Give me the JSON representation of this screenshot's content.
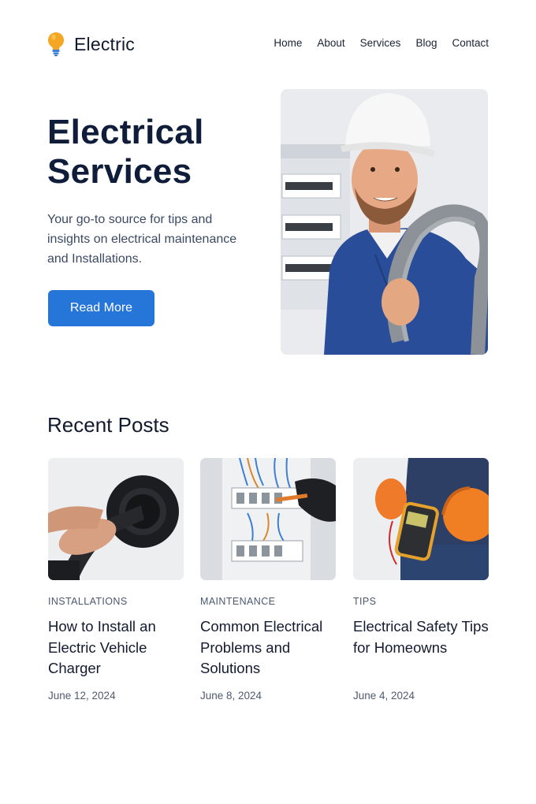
{
  "brand": {
    "name": "Electric",
    "icon": "lightbulb-icon",
    "accent": "#f5a623"
  },
  "nav": {
    "items": [
      "Home",
      "About",
      "Services",
      "Blog",
      "Contact"
    ]
  },
  "hero": {
    "title": "Electrical Services",
    "text": "Your go-to source for tips and insights on electrical maintenance and Installations.",
    "button": "Read More",
    "button_color": "#2675d9",
    "image": "electrician-photo"
  },
  "recent": {
    "title": "Recent Posts",
    "posts": [
      {
        "category": "INSTALLATIONS",
        "title": "How to Install an Electric Vehicle Charger",
        "date": "June 12, 2024",
        "image": "ev-charger-photo"
      },
      {
        "category": "MAINTENANCE",
        "title": "Common Electrical Problems and Solutions",
        "date": "June 8, 2024",
        "image": "electrical-panel-photo"
      },
      {
        "category": "TIPS",
        "title": "Electrical Safety Tips for Homeowns",
        "date": "June 4, 2024",
        "image": "multimeter-photo"
      }
    ]
  }
}
